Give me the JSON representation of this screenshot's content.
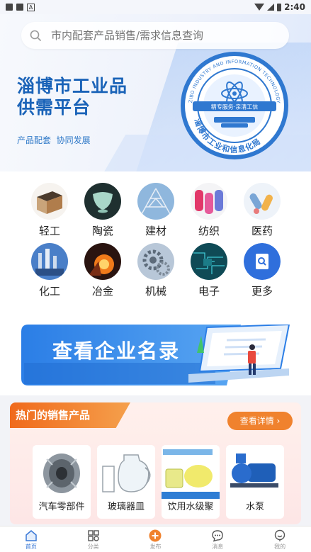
{
  "status_bar": {
    "time": "2:40"
  },
  "search": {
    "placeholder": "市内配套产品销售/需求信息查询"
  },
  "hero": {
    "title": "淄博市工业品供需平台",
    "subtitle": "产品配套  协同发展",
    "seal": {
      "ring_text_en": "ZIBO INDUSTRY AND INFORMATION TECHNOLOGY BUREAU",
      "band_text": "精专服务·亲清工信",
      "bottom_text": "淄博市工业和信息化局"
    }
  },
  "categories": [
    {
      "label": "轻工",
      "icon": "light-industry-icon"
    },
    {
      "label": "陶瓷",
      "icon": "ceramics-icon"
    },
    {
      "label": "建材",
      "icon": "building-materials-icon"
    },
    {
      "label": "纺织",
      "icon": "textile-icon"
    },
    {
      "label": "医药",
      "icon": "medicine-icon"
    },
    {
      "label": "化工",
      "icon": "chemical-icon"
    },
    {
      "label": "冶金",
      "icon": "metallurgy-icon"
    },
    {
      "label": "机械",
      "icon": "machinery-icon"
    },
    {
      "label": "电子",
      "icon": "electronics-icon"
    },
    {
      "label": "更多",
      "icon": "more-icon"
    }
  ],
  "banner": {
    "text": "查看企业名录"
  },
  "hot_products": {
    "title": "热门的销售产品",
    "more_label": "查看详情 ›",
    "items": [
      {
        "label": "汽车零部件",
        "icon": "auto-parts-icon"
      },
      {
        "label": "玻璃器皿",
        "icon": "glassware-icon"
      },
      {
        "label": "饮用水级聚",
        "icon": "water-chemical-icon"
      },
      {
        "label": "水泵",
        "icon": "water-pump-icon"
      }
    ]
  },
  "tabbar": [
    {
      "label": "首页",
      "icon": "home-icon",
      "active": true
    },
    {
      "label": "分类",
      "icon": "category-icon",
      "active": false
    },
    {
      "label": "发布",
      "icon": "publish-icon",
      "active": false
    },
    {
      "label": "消息",
      "icon": "message-icon",
      "active": false
    },
    {
      "label": "我的",
      "icon": "profile-icon",
      "active": false
    }
  ],
  "colors": {
    "brand_blue": "#1a63b8",
    "accent_orange": "#f0822e",
    "tab_active": "#3a78d6"
  }
}
